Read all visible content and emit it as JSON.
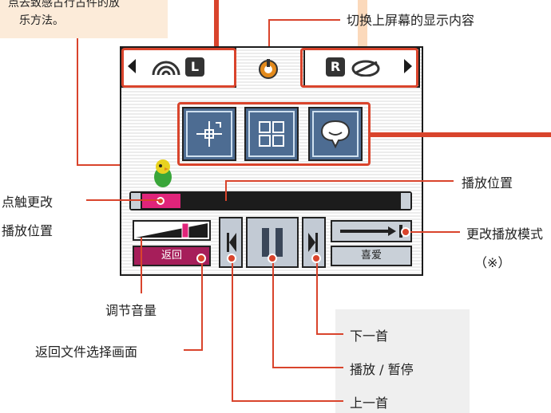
{
  "callouts": {
    "top_left_line1": "点去致感古行古件的放",
    "top_left_line2": "乐方法。",
    "switch_upper": "切换上屏幕的显示内容",
    "seek_position": "播放位置",
    "tap_change_1": "点触更改",
    "tap_change_2": "播放位置",
    "change_mode": "更改播放模式",
    "mode_note": "（※）",
    "volume": "调节音量",
    "back_to_file": "返回文件选择画面",
    "next": "下一首",
    "play_pause": "播放 / 暂停",
    "prev": "上一首"
  },
  "screen": {
    "left_tab_letter": "L",
    "right_tab_letter": "R",
    "back_label": "返回",
    "favorite_label": "喜爱"
  },
  "progress": {
    "fraction": 0.15,
    "volume_fraction": 0.7
  },
  "colors": {
    "accent": "#d9442c",
    "pink": "#e0247a",
    "tile": "#4d6c92",
    "callout_bg": "#fcebd9"
  },
  "icons": [
    "left-arrow-icon",
    "speaker-icon",
    "logo-icon",
    "satellite-icon",
    "right-arrow-icon",
    "move-icon",
    "grid-icon",
    "speech-bubble-icon",
    "bird-icon",
    "prev-track-icon",
    "pause-icon",
    "next-track-icon",
    "play-mode-icon"
  ]
}
